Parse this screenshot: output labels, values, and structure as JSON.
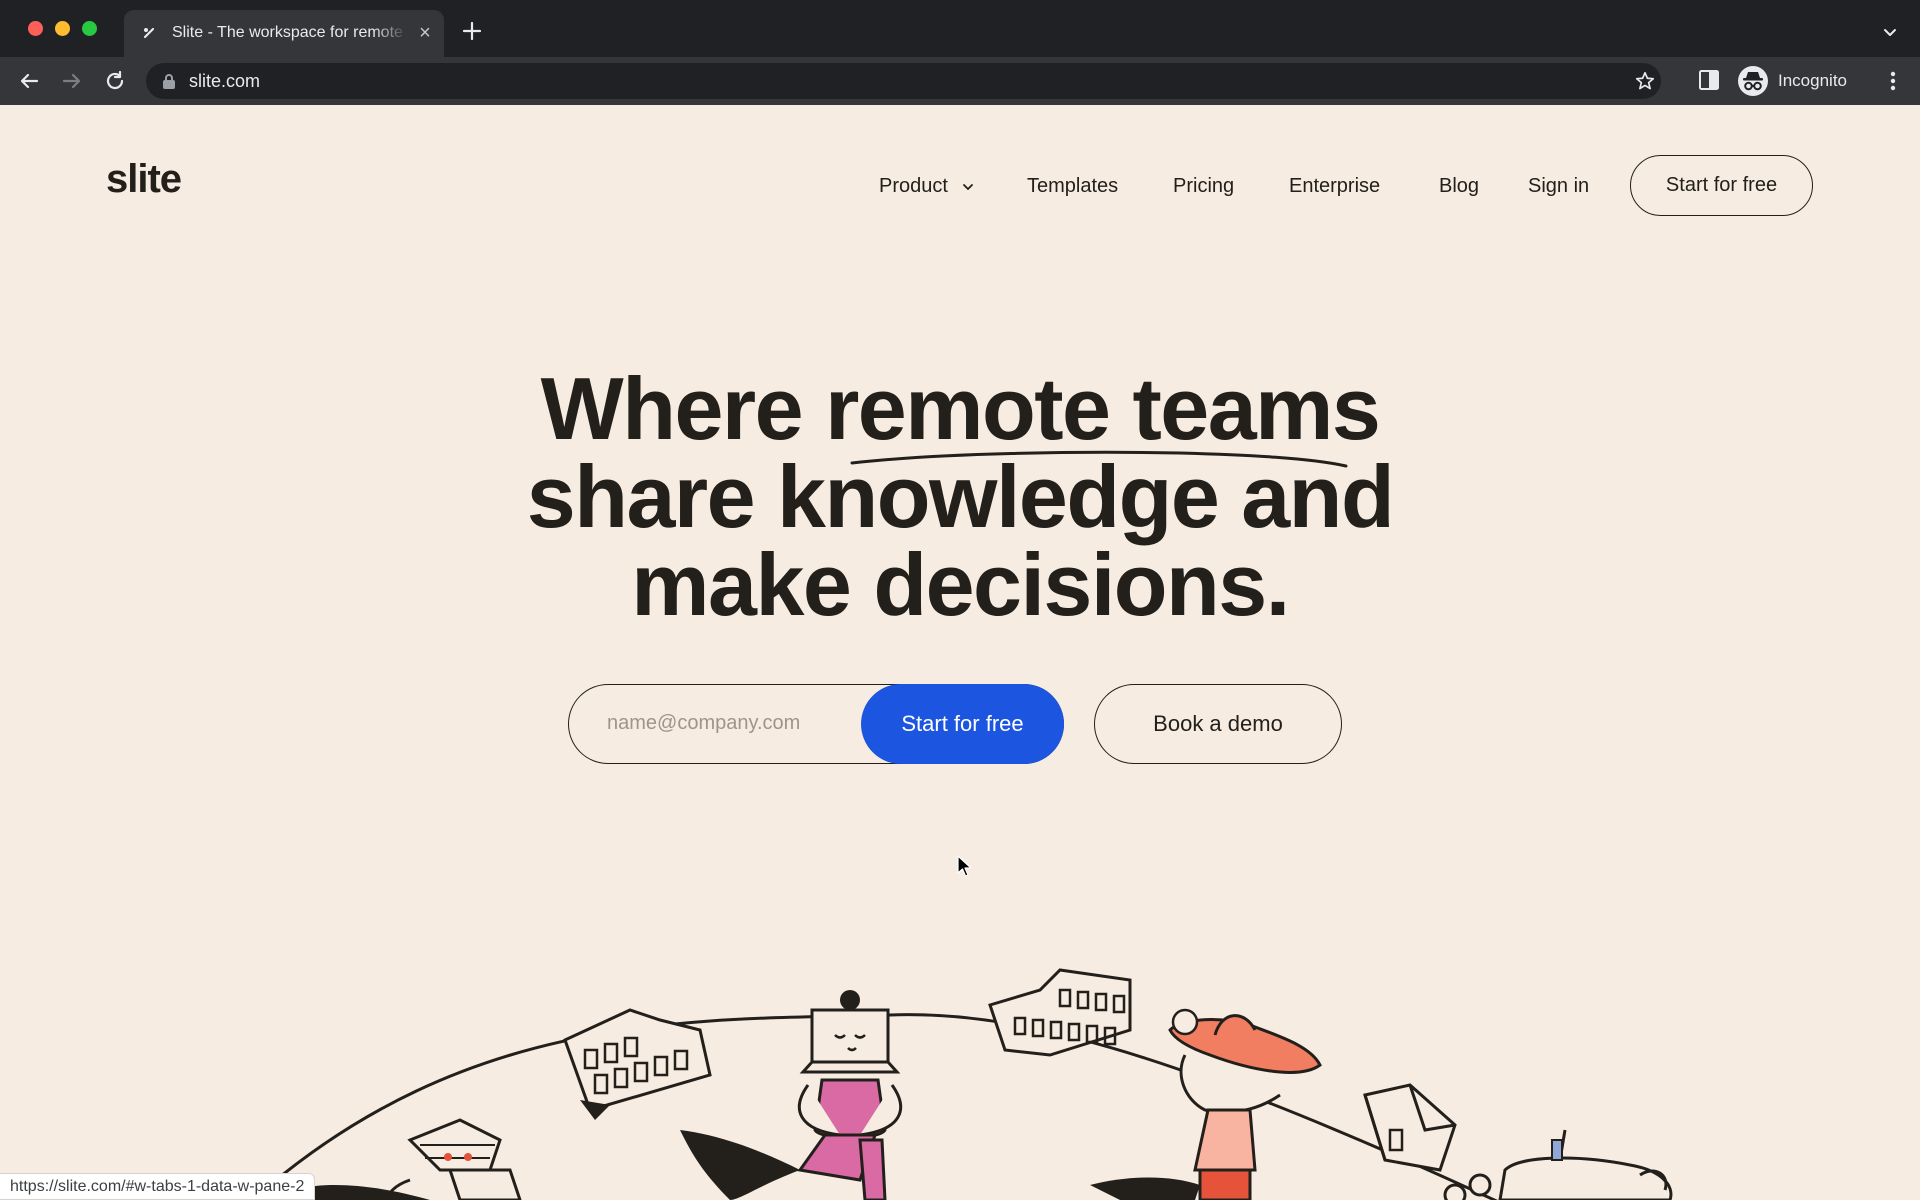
{
  "browser": {
    "tab": {
      "title": "Slite - The workspace for remote teams",
      "close_glyph": "×"
    },
    "toolbar": {
      "url": "slite.com",
      "profile_label": "Incognito"
    },
    "icons": [
      "back-arrow-icon",
      "forward-arrow-icon",
      "reload-icon",
      "lock-icon",
      "star-icon",
      "side-panel-icon",
      "incognito-icon",
      "more-vert-icon",
      "new-tab-plus-icon",
      "tab-search-chevron-icon"
    ],
    "status_url": "https://slite.com/#w-tabs-1-data-w-pane-2"
  },
  "header": {
    "logo": "slite",
    "nav": {
      "product": "Product",
      "templates": "Templates",
      "pricing": "Pricing",
      "enterprise": "Enterprise",
      "blog": "Blog",
      "signin": "Sign in"
    },
    "cta": "Start for free"
  },
  "hero": {
    "line1_a": "Where ",
    "line1_b": "remote teams",
    "line2": "share knowledge and",
    "line3": "make decisions."
  },
  "signup": {
    "email_placeholder": "name@company.com",
    "email_value": "",
    "submit_label": "Start for free",
    "demo_label": "Book a demo"
  },
  "colors": {
    "page_bg": "#f6ece2",
    "ink": "#23201c",
    "primary": "#1c55e0",
    "pink": "#d96aa4",
    "coral": "#f27e62",
    "red_orange": "#e5533a"
  }
}
